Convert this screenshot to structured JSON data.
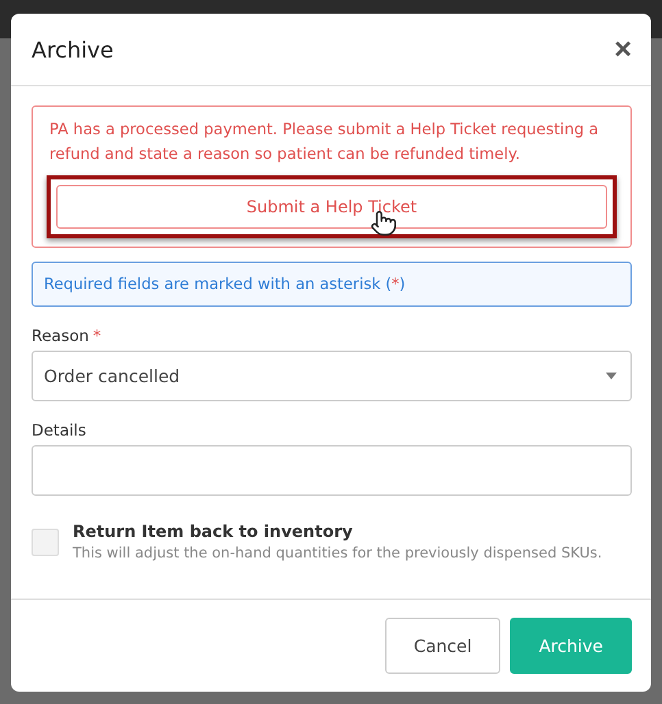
{
  "dialog": {
    "title": "Archive",
    "close": "×"
  },
  "alert": {
    "message": "PA has a processed payment. Please submit a Help Ticket requesting a refund and state a reason so patient can be refunded timely.",
    "button": "Submit a Help Ticket",
    "highlighted": true
  },
  "info": {
    "text": "Required fields are marked with an asterisk (",
    "mark": "*",
    "end": ")"
  },
  "fields": [
    {
      "kind": "select",
      "label": "Reason",
      "required": true,
      "value": "Order cancelled"
    },
    {
      "kind": "text",
      "label": "Details",
      "required": false
    }
  ],
  "return_item": {
    "label": "Return Item back to inventory",
    "hint": "This will adjust the on-hand quantities for the previously dispensed SKUs.",
    "checked": false
  },
  "buttons": [
    {
      "label": "Cancel",
      "kind": "secondary"
    },
    {
      "label": "Archive",
      "kind": "primary"
    }
  ]
}
